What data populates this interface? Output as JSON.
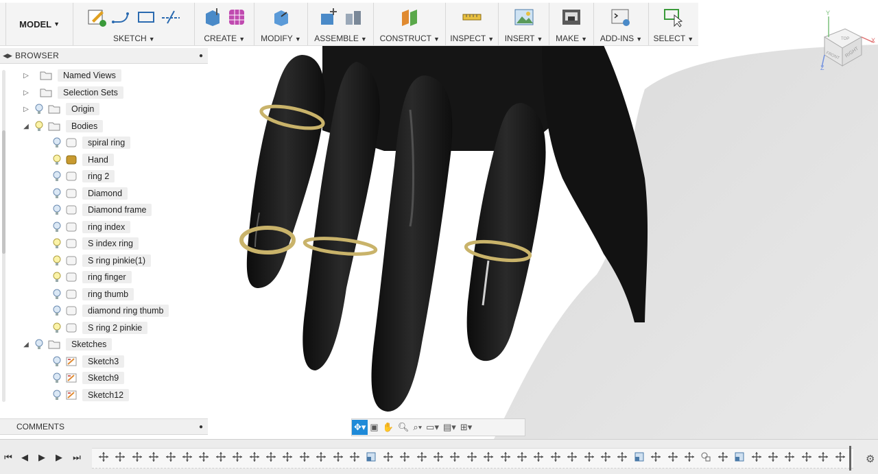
{
  "toolbar": {
    "workspace": "MODEL",
    "groups": [
      {
        "label": "SKETCH"
      },
      {
        "label": "CREATE"
      },
      {
        "label": "MODIFY"
      },
      {
        "label": "ASSEMBLE"
      },
      {
        "label": "CONSTRUCT"
      },
      {
        "label": "INSPECT"
      },
      {
        "label": "INSERT"
      },
      {
        "label": "MAKE"
      },
      {
        "label": "ADD-INS"
      },
      {
        "label": "SELECT"
      }
    ]
  },
  "browser": {
    "title": "BROWSER",
    "items": [
      {
        "label": "Named Views"
      },
      {
        "label": "Selection Sets"
      },
      {
        "label": "Origin"
      },
      {
        "label": "Bodies"
      },
      {
        "label": "spiral ring"
      },
      {
        "label": "Hand"
      },
      {
        "label": "ring 2"
      },
      {
        "label": "Diamond"
      },
      {
        "label": "Diamond frame"
      },
      {
        "label": "ring index"
      },
      {
        "label": "S index ring"
      },
      {
        "label": "S ring pinkie(1)"
      },
      {
        "label": "ring finger"
      },
      {
        "label": "ring thumb"
      },
      {
        "label": "diamond ring thumb"
      },
      {
        "label": "S ring 2 pinkie"
      },
      {
        "label": "Sketches"
      },
      {
        "label": "Sketch3"
      },
      {
        "label": "Sketch9"
      },
      {
        "label": "Sketch12"
      }
    ]
  },
  "comments": {
    "title": "COMMENTS"
  },
  "viewcube": {
    "top": "TOP",
    "front": "FRONT",
    "right": "RIGHT",
    "axis_x": "X",
    "axis_y": "Y",
    "axis_z": "Z"
  },
  "colors": {
    "accent": "#1f8ad8",
    "hand": "#1a1a1a",
    "ring": "#c9b36a",
    "toolbar_bg": "#f4f4f4"
  }
}
